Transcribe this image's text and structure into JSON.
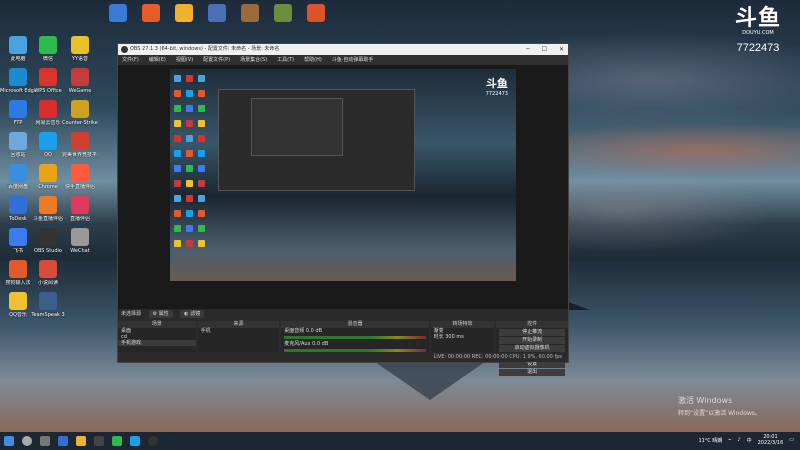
{
  "desktop": {
    "icons": [
      {
        "label": "此电脑",
        "color": "#4aa3df"
      },
      {
        "label": "Microsoft Edge",
        "color": "#1b8ad1"
      },
      {
        "label": "FTP",
        "color": "#2c7be5"
      },
      {
        "label": "回收站",
        "color": "#6fa8dc"
      },
      {
        "label": "百度网盘",
        "color": "#3b8de0"
      },
      {
        "label": "ToDesk",
        "color": "#2f6fd6"
      },
      {
        "label": "飞书",
        "color": "#3d7bf0"
      },
      {
        "label": "搜狗输入法",
        "color": "#e05a2a"
      },
      {
        "label": "QQ音乐",
        "color": "#f0c030"
      },
      {
        "label": "微信",
        "color": "#2dbb4e"
      },
      {
        "label": "WPS Office",
        "color": "#d9342b"
      },
      {
        "label": "网易云音乐",
        "color": "#d92c2c"
      },
      {
        "label": "QQ",
        "color": "#18a0ea"
      },
      {
        "label": "Chrome",
        "color": "#e8a317"
      },
      {
        "label": "斗鱼直播伴侣",
        "color": "#f07a24"
      },
      {
        "label": "OBS Studio",
        "color": "#333333"
      },
      {
        "label": "小说阅读",
        "color": "#d84a3a"
      },
      {
        "label": "TeamSpeak 3",
        "color": "#3b5e8c"
      },
      {
        "label": "YY语音",
        "color": "#e6c12a"
      },
      {
        "label": "WeGame",
        "color": "#c43b3b"
      },
      {
        "label": "Counter-Strike Global Off...",
        "color": "#d0a020"
      },
      {
        "label": "完美世界竞技平台",
        "color": "#d04030"
      },
      {
        "label": "快手直播伴侣",
        "color": "#ff5a3c"
      },
      {
        "label": "直播伴侣",
        "color": "#e03a5a"
      },
      {
        "label": "WeChat",
        "color": "#999999"
      }
    ],
    "top_icons": [
      {
        "label": "",
        "color": "#3a7bd5"
      },
      {
        "label": "",
        "color": "#e85c2a"
      },
      {
        "label": "",
        "color": "#f0b030"
      },
      {
        "label": "",
        "color": "#4a6fb5"
      },
      {
        "label": "",
        "color": "#9a6a3a"
      },
      {
        "label": "",
        "color": "#6b8e3a"
      },
      {
        "label": "",
        "color": "#d9542a"
      }
    ],
    "brand": {
      "logo": "斗鱼",
      "url": "DOUYU.COM",
      "room": "7722473"
    },
    "activate": {
      "line1": "激活 Windows",
      "line2": "转到“设置”以激活 Windows。"
    }
  },
  "obs": {
    "title": "OBS 27.1.3 (64-bit, windows) - 配置文件: 未命名 - 场景: 未命名",
    "menu": [
      "文件(F)",
      "编辑(E)",
      "视图(V)",
      "配置文件(P)",
      "场景集合(S)",
      "工具(T)",
      "帮助(H)",
      "斗鱼·自动弹幕助手"
    ],
    "scene_info": "未选择源",
    "tab_props": "属性",
    "tab_filters": "滤镜",
    "docks": {
      "scenes": {
        "title": "场景",
        "items": [
          "桌面",
          "cd",
          "手机游戏"
        ]
      },
      "sources": {
        "title": "来源",
        "items": [
          "手机"
        ]
      },
      "mixer": {
        "title": "混音器",
        "ch1": "桌面音频",
        "ch1_db": "0.0 dB",
        "ch2": "麦克风/Aux",
        "ch2_db": "0.0 dB"
      },
      "transitions": {
        "title": "转场特效",
        "type": "渐变",
        "duration_label": "时长",
        "duration": "300 ms"
      },
      "controls": {
        "title": "控件",
        "buttons": [
          "停止推流",
          "开始录制",
          "启动虚拟摄像机",
          "工作室模式",
          "设置",
          "退出"
        ]
      }
    },
    "status": "LIVE: 00:00:00   REC: 00:00:00   CPU: 1.9%, 60.00 fps",
    "preview_logo": "斗鱼",
    "preview_room": "7722473"
  },
  "taskbar": {
    "time": "20:01",
    "date": "2022/3/16",
    "weather": "11°C 晴朗",
    "lang": "中"
  }
}
